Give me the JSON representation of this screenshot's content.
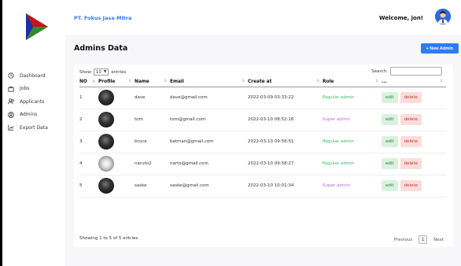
{
  "header": {
    "company": "PT. Fokus Jasa Mitra",
    "welcome": "Welcome, jon!"
  },
  "sidebar": {
    "items": [
      {
        "label": "Dashboard",
        "icon": "clock-icon",
        "active": false
      },
      {
        "label": "Jobs",
        "icon": "briefcase-icon",
        "active": false
      },
      {
        "label": "Applicants",
        "icon": "users-icon",
        "active": false
      },
      {
        "label": "Admins",
        "icon": "user-circle-icon",
        "active": true
      },
      {
        "label": "Export Data",
        "icon": "chart-icon",
        "active": false
      }
    ]
  },
  "main": {
    "title": "Admins Data",
    "new_admin_label": "+ New Admin",
    "show_label": "Show",
    "entries_value": "10",
    "entries_label": "entries",
    "search_label": "Search:",
    "columns": [
      "NO",
      "Profile",
      "Name",
      "Email",
      "Create at",
      "Role",
      "..."
    ],
    "rows": [
      {
        "no": "1",
        "profile": "dark",
        "name": "dave",
        "email": "dave@gmail.com",
        "created": "2022-03-09 03:33:22",
        "role": "Regular admin",
        "role_type": "regular"
      },
      {
        "no": "2",
        "profile": "dark",
        "name": "tom",
        "email": "tom@gmail.com",
        "created": "2022-03-10 08:52:16",
        "role": "Super admin",
        "role_type": "super"
      },
      {
        "no": "3",
        "profile": "dark",
        "name": "bruce",
        "email": "batman@gmail.com",
        "created": "2022-03-10 09:56:51",
        "role": "Regular admin",
        "role_type": "regular"
      },
      {
        "no": "4",
        "profile": "light",
        "name": "naruto2",
        "email": "narto@gmail.com",
        "created": "2022-03-10 09:58:27",
        "role": "Regular admin",
        "role_type": "regular"
      },
      {
        "no": "5",
        "profile": "dark",
        "name": "saske",
        "email": "saske@gmail.com",
        "created": "2022-03-10 10:01:34",
        "role": "Super admin",
        "role_type": "super"
      }
    ],
    "edit_label": "edit",
    "delete_label": "delete",
    "showing_text": "Showing 1 to 5 of 5 entries",
    "previous_label": "Previous",
    "current_page": "1",
    "next_label": "Next"
  },
  "colors": {
    "accent": "#2f7bf5",
    "regular_role": "#3fb56e",
    "super_role": "#b46de0"
  }
}
